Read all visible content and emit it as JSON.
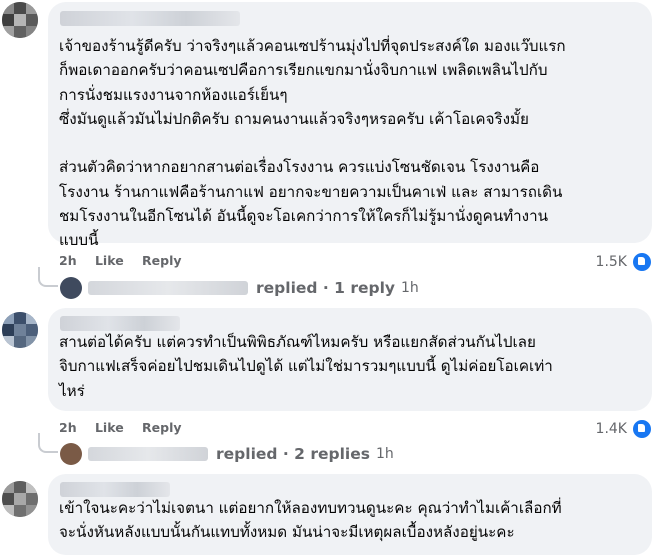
{
  "comments": [
    {
      "text": "เจ้าของร้านรู้ดีครับ ว่าจริงๆแล้วคอนเซปร้านมุ่งไปที่จุดประสงค์ใด มองแว๊บแรก\nก็พอเดาออกครับว่าคอนเซปคือการเรียกแขกมานั่งจิบกาแฟ เพลิดเพลินไปกับ\nการนั่งชมแรงงานจากห้องแอร์เย็นๆ\nซึ่งมันดูแล้วมันไม่ปกติครับ ถามคนงานแล้วจริงๆหรอครับ เค้าโอเคจริงมั้ย\n\nส่วนตัวคิดว่าหากอยากสานต่อเรื่องโรงงาน ควรแบ่งโซนชัดเจน โรงงานคือ\nโรงงาน ร้านกาแฟคือร้านกาแฟ อยากจะขายความเป็นคาเฟ่ และ สามารถเดิน\nชมโรงงานในอีกโซนได้ อันนี้ดูจะโอเคกว่าการให้ใครก็ไม่รู้มานั่งดูคนทำงาน\nแบบนี้",
      "time": "2h",
      "like": "Like",
      "reply": "Reply",
      "reactions": "1.5K",
      "replies_label": "replied · 1 reply",
      "replies_time": "1h"
    },
    {
      "text": "สานต่อได้ครับ แต่ควรทำเป็นพิพิธภัณฑ์ไหมครับ หรือแยกสัดส่วนกันไปเลย\nจิบกาแฟเสร็จค่อยไปชมเดินไปดูได้ แต่ไม่ใช่มารวมๆแบบนี้ ดูไม่ค่อยโอเคเท่า\nไหร่",
      "time": "2h",
      "like": "Like",
      "reply": "Reply",
      "reactions": "1.4K",
      "replies_label": "replied · 2 replies",
      "replies_time": "1h"
    },
    {
      "text": "เข้าใจนะคะว่าไม่เจตนา แต่อยากให้ลองทบทวนดูนะคะ คุณว่าทำไมเค้าเลือกที่\nจะนั่งหันหลังแบบนั้นกันแทบทั้งหมด มันน่าจะมีเหตุผลเบื้องหลังอยู่นะคะ"
    }
  ],
  "colors": {
    "bubble": "#f0f2f5",
    "meta": "#65676b",
    "reaction": "#1877f2"
  }
}
